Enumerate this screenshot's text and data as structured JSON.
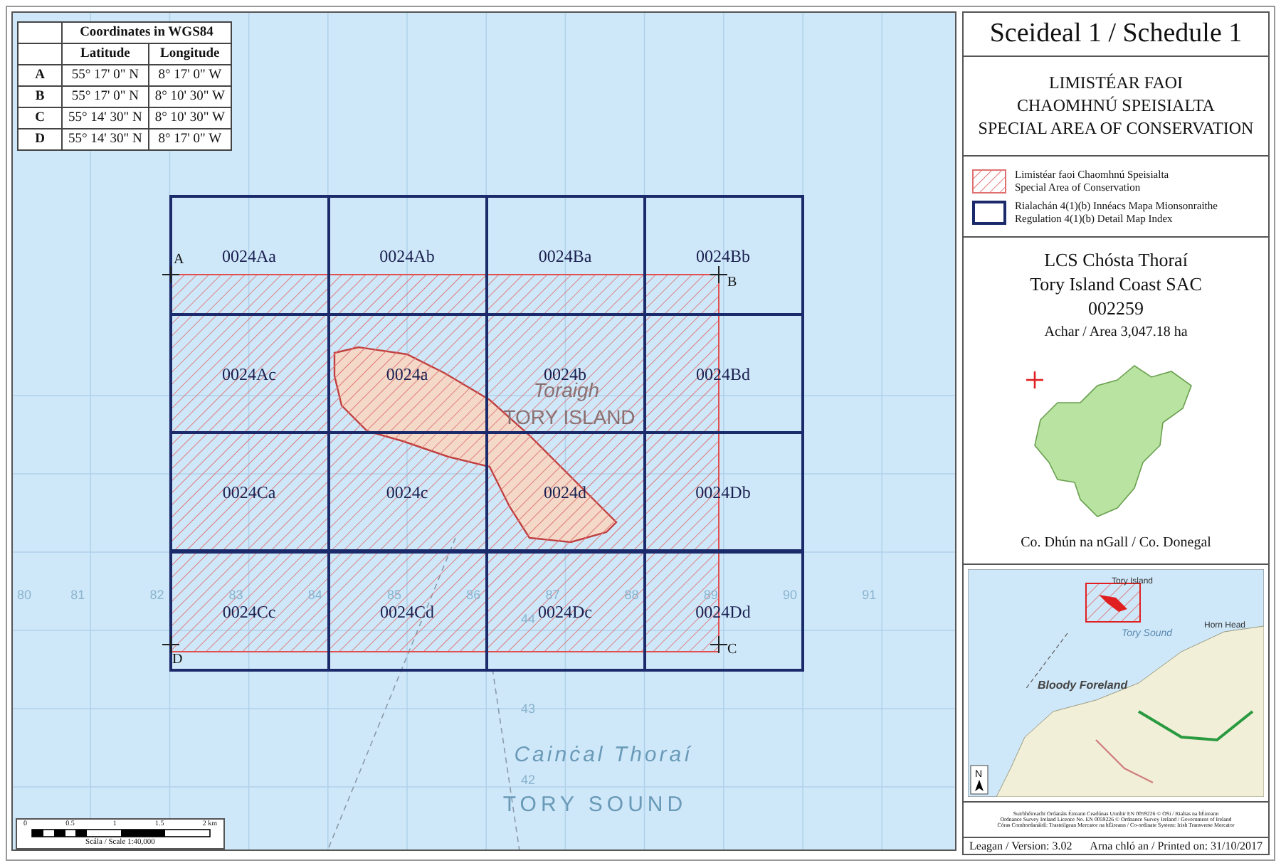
{
  "coordinates_table": {
    "title": "Coordinates in WGS84",
    "columns": [
      "Latitude",
      "Longitude"
    ],
    "rows": [
      {
        "point": "A",
        "latitude": "55° 17' 0\" N",
        "longitude": "8° 17' 0\" W"
      },
      {
        "point": "B",
        "latitude": "55° 17' 0\" N",
        "longitude": "8° 10' 30\" W"
      },
      {
        "point": "C",
        "latitude": "55° 14' 30\" N",
        "longitude": "8° 10' 30\" W"
      },
      {
        "point": "D",
        "latitude": "55° 14' 30\" N",
        "longitude": "8° 17' 0\" W"
      }
    ]
  },
  "map": {
    "sheets": [
      "0024Aa",
      "0024Ab",
      "0024Ba",
      "0024Bb",
      "0024Ac",
      "0024a",
      "0024b",
      "0024Bd",
      "0024Ca",
      "0024c",
      "0024d",
      "0024Db",
      "0024Cc",
      "0024Cd",
      "0024Dc",
      "0024Dd"
    ],
    "points": [
      "A",
      "B",
      "C",
      "D"
    ],
    "place_labels": [
      "Toraigh",
      "TORY ISLAND",
      "Cainċal Thoraí",
      "TORY SOUND"
    ],
    "eastings": [
      "80",
      "81",
      "82",
      "83",
      "84",
      "85",
      "86",
      "87",
      "88",
      "89",
      "90",
      "91"
    ],
    "northings": [
      "44",
      "43",
      "42"
    ],
    "scale_bar": {
      "ticks": [
        "0",
        "0.5",
        "1",
        "1.5",
        "2 km"
      ],
      "caption": "Scála / Scale 1:40,000"
    }
  },
  "panel": {
    "title": "Sceideal 1 / Schedule 1",
    "designation": [
      "LIMISTÉAR FAOI",
      "CHAOMHNÚ SPEISIALTA",
      "SPECIAL AREA OF CONSERVATION"
    ],
    "legend": [
      {
        "kind": "hatch",
        "lines": [
          "Limistéar faoi Chaomhnú Speisialta",
          "Special Area of Conservation"
        ]
      },
      {
        "kind": "outline",
        "lines": [
          "Rialachán 4(1)(b) Innéacs Mapa Mionsonraithe",
          "Regulation 4(1)(b) Detail Map Index"
        ]
      }
    ],
    "site": {
      "name_ga": "LCS Chósta Thoraí",
      "name_en": "Tory Island Coast SAC",
      "code": "002259",
      "area": "Achar / Area 3,047.18 ha",
      "county": "Co. Dhún na nGall / Co. Donegal"
    },
    "inset_labels": [
      "Tory Island",
      "Tory Sound",
      "Bloody Foreland",
      "Horn Head"
    ],
    "north_label": "N",
    "credits": [
      "Suirbhéireacht Ordanáis Éireann Ceadúnas Uimhir EN 0059226 © OSi / Rialtas na hÉireann",
      "Ordnance Survey Ireland Licence No. EN 0059226 © Ordnance Survey Ireland / Government of Ireland",
      "Córas Comhordanáidí: Trasteilgean Mercator na hÉireann / Co-ordinate System: Irish Transverse Mercator"
    ],
    "version": "Leagan / Version: 3.02",
    "printed": "Arna chló an / Printed on: 31/10/2017"
  }
}
